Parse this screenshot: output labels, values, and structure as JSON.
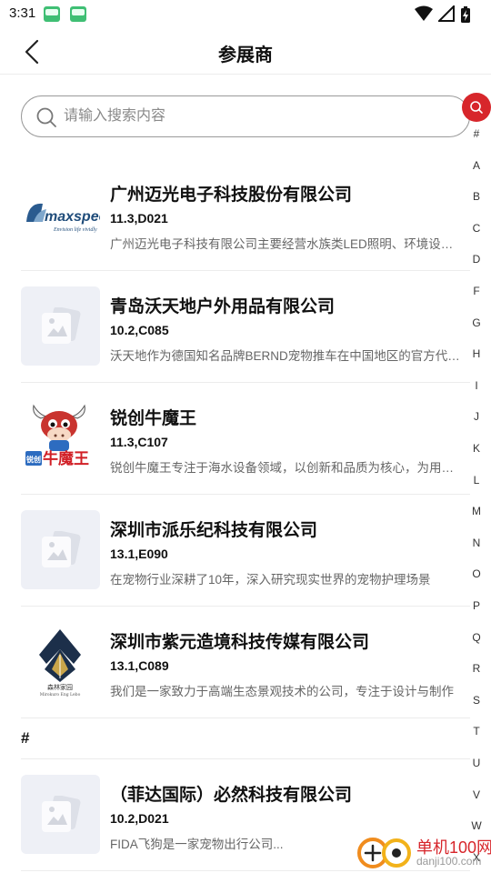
{
  "status_bar": {
    "time": "3:31",
    "icons": [
      "app-notification-icon",
      "app-notification-icon",
      "wifi-icon",
      "signal-icon",
      "battery-charging-icon"
    ]
  },
  "header": {
    "title": "参展商",
    "back_icon": "chevron-left-icon"
  },
  "search": {
    "placeholder": "请输入搜索内容",
    "value": ""
  },
  "index_bar": {
    "search_icon": "search-icon",
    "letters": [
      "#",
      "A",
      "B",
      "C",
      "D",
      "F",
      "G",
      "H",
      "I",
      "J",
      "K",
      "L",
      "M",
      "N",
      "O",
      "P",
      "Q",
      "R",
      "S",
      "T",
      "U",
      "V",
      "W",
      "X"
    ]
  },
  "exhibitors": [
    {
      "name": "广州迈光电子科技股份有限公司",
      "booth": "11.3,D021",
      "desc": "广州迈光电子科技有限公司主要经营水族类LED照明、环境设备等产品",
      "logo": {
        "type": "maxspect",
        "wordmark": "maxspect",
        "tagline": "Envision life vividly"
      }
    },
    {
      "name": "青岛沃天地户外用品有限公司",
      "booth": "10.2,C085",
      "desc": "沃天地作为德国知名品牌BERND宠物推车在中国地区的官方代理商",
      "logo": {
        "type": "placeholder"
      }
    },
    {
      "name": "锐创牛魔王",
      "booth": "11.3,C107",
      "desc": "锐创牛魔王专注于海水设备领域，以创新和品质为核心，为用户提供优质产品",
      "logo": {
        "type": "niumowang",
        "wordmark": "牛魔王",
        "prefix": "锐创"
      }
    },
    {
      "name": "深圳市派乐纪科技有限公司",
      "booth": "13.1,E090",
      "desc": "在宠物行业深耕了10年，深入研究现实世界的宠物护理场景",
      "logo": {
        "type": "placeholder"
      }
    },
    {
      "name": "深圳市紫元造境科技传媒有限公司",
      "booth": "13.1,C089",
      "desc": "我们是一家致力于高端生态景观技术的公司，专注于设计与制作",
      "logo": {
        "type": "senlin",
        "wordmark": "森林家园",
        "tagline": "Mirokuro Eng Lebo"
      }
    }
  ],
  "sections": [
    {
      "label": "#",
      "items": [
        {
          "name": "（菲达国际）必然科技有限公司",
          "booth": "10.2,D021",
          "desc": "FIDA飞狗是一家宠物出行公司...",
          "logo": {
            "type": "placeholder"
          }
        }
      ]
    }
  ],
  "watermark": {
    "text": "单机100网",
    "url": "danji100.com"
  },
  "colors": {
    "accent": "#d7262b",
    "placeholder_bg": "#eef0f6",
    "divider": "#ececec"
  }
}
